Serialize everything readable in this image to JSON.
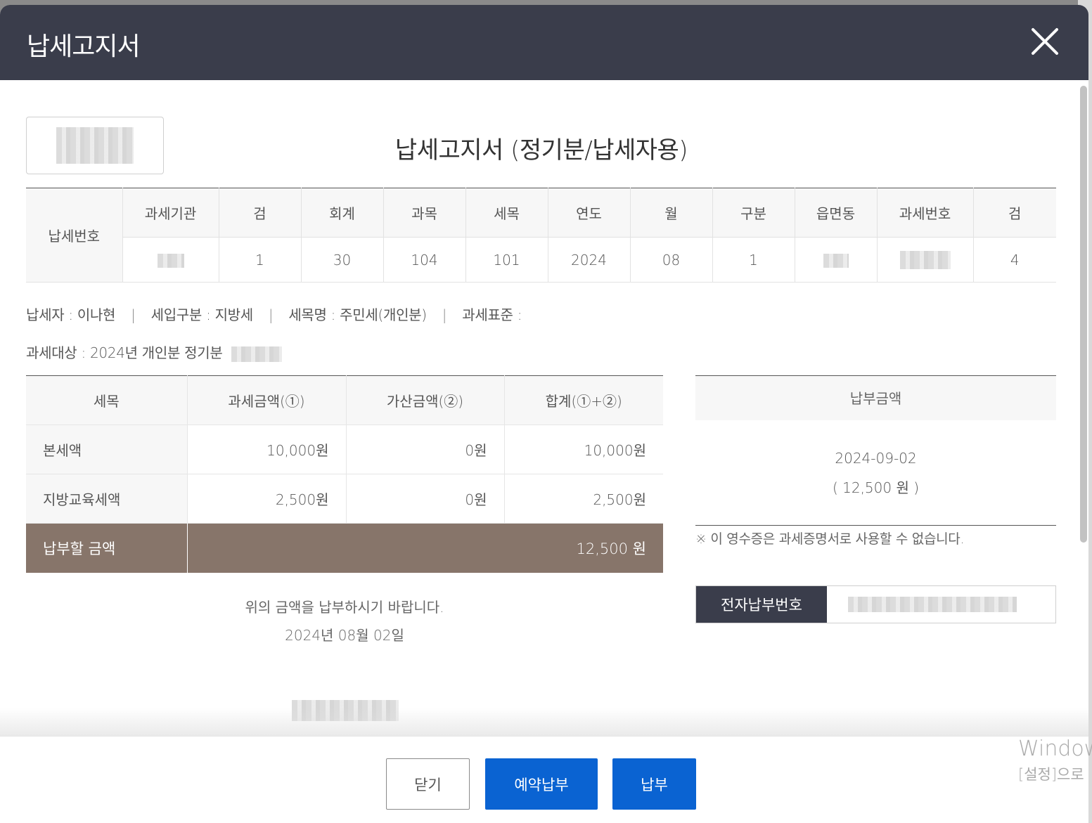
{
  "modal": {
    "title": "납세고지서"
  },
  "document": {
    "title": "납세고지서 (정기분/납세자용)"
  },
  "tax_number": {
    "row_label": "납세번호",
    "headers": [
      "과세기관",
      "검",
      "회계",
      "과목",
      "세목",
      "연도",
      "월",
      "구분",
      "읍면동",
      "과세번호",
      "검"
    ],
    "values": [
      "",
      "1",
      "30",
      "104",
      "101",
      "2024",
      "08",
      "1",
      "",
      "",
      "4"
    ]
  },
  "taxpayer_info": {
    "taxpayer": "납세자 : 이나현",
    "tax_type": "세입구분 : 지방세",
    "tax_item": "세목명 : 주민세(개인분)",
    "tax_standard": "과세표준 :",
    "separator": "|",
    "target": "과세대상 : 2024년 개인분 정기분"
  },
  "amount_table": {
    "headers": [
      "세목",
      "과세금액(①)",
      "가산금액(②)",
      "합계(①+②)"
    ],
    "rows": [
      {
        "label": "본세액",
        "tax": "10,000원",
        "surcharge": "0원",
        "total": "10,000원"
      },
      {
        "label": "지방교육세액",
        "tax": "2,500원",
        "surcharge": "0원",
        "total": "2,500원"
      }
    ],
    "total_label": "납부할 금액",
    "total_value": "12,500 원"
  },
  "payment": {
    "header": "납부금액",
    "due_date": "2024-09-02",
    "amount": "( 12,500 원 )",
    "note": "※ 이 영수증은 과세증명서로 사용할 수 없습니다."
  },
  "epay": {
    "label": "전자납부번호"
  },
  "request": {
    "text": "위의 금액을 납부하시기 바랍니다.",
    "date": "2024년 08월 02일"
  },
  "buttons": {
    "close": "닫기",
    "reserve": "예약납부",
    "pay": "납부"
  },
  "os_watermark": {
    "line1": "Windows",
    "line2": "[설정]으로"
  },
  "colors": {
    "header_bg": "#3a3d4b",
    "total_row_bg": "#87756a",
    "primary_button": "#0a63d2"
  },
  "icons": {
    "close": "close-x-icon"
  }
}
